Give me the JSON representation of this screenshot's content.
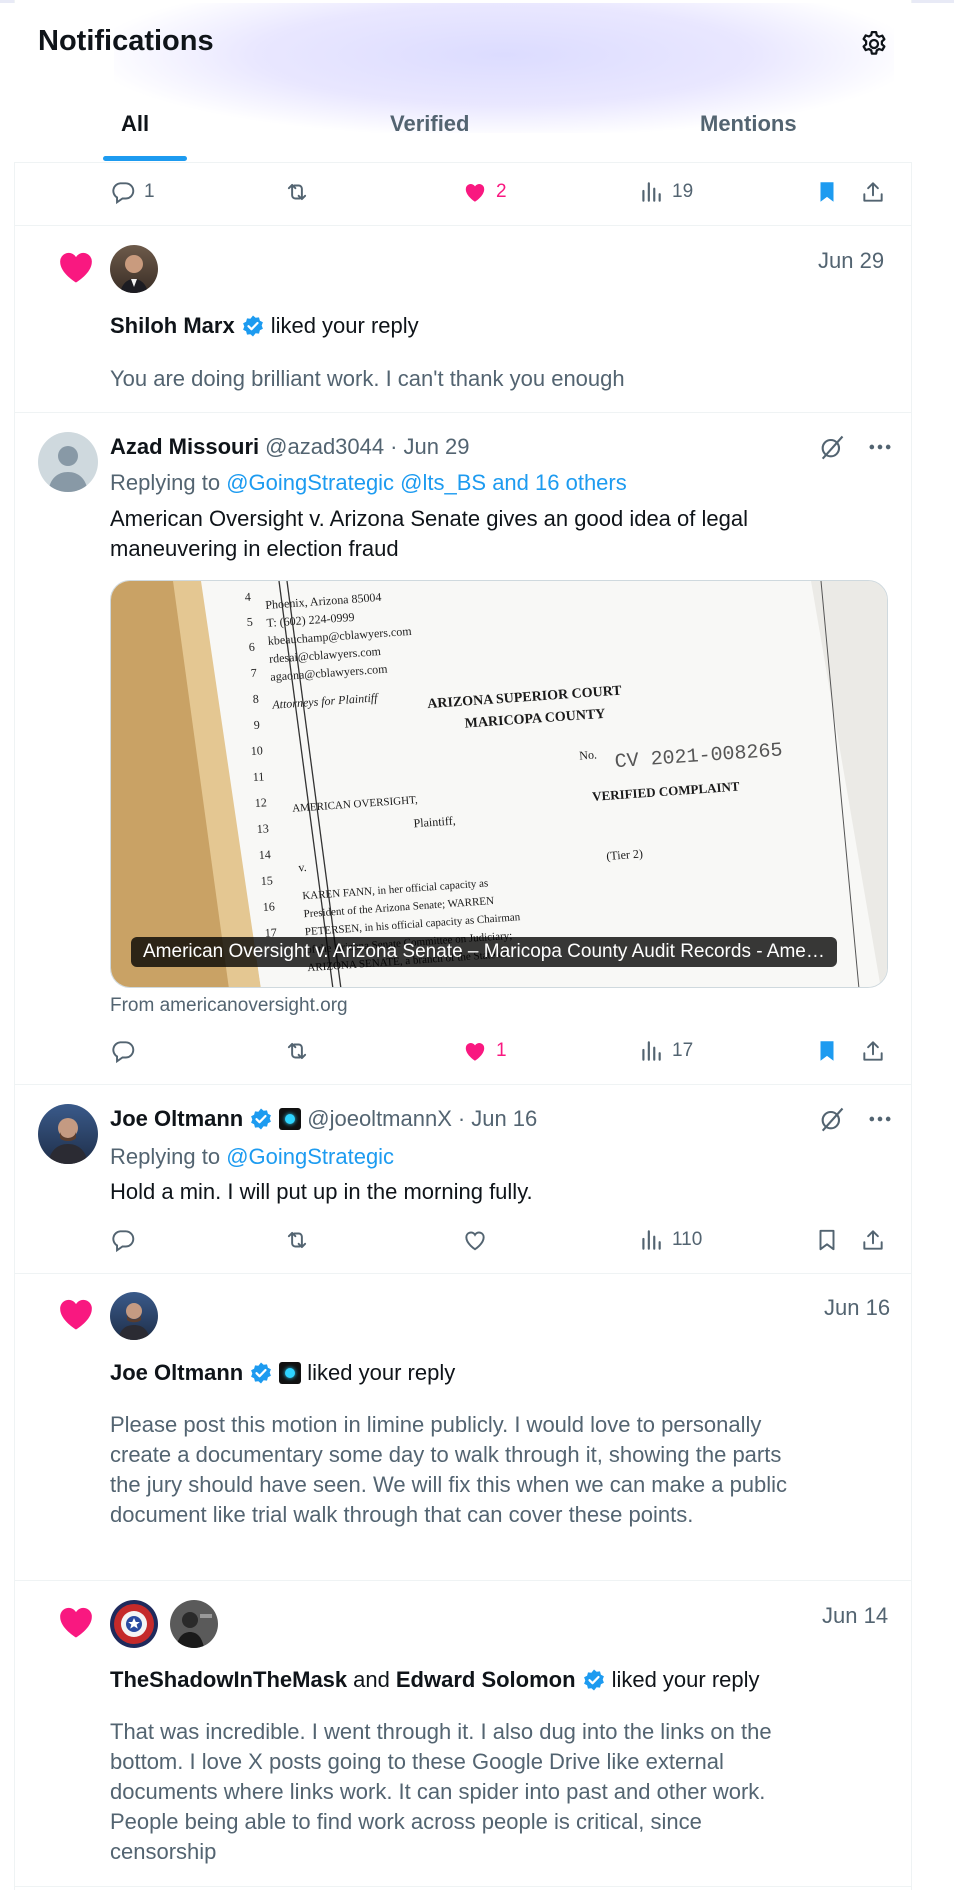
{
  "header": {
    "title": "Notifications",
    "tabs": [
      "All",
      "Verified",
      "Mentions"
    ],
    "active_tab": "All",
    "settings_icon": "gear-icon"
  },
  "colors": {
    "accent": "#1d9bf0",
    "like": "#f91880",
    "muted": "#536471",
    "text": "#0f1419"
  },
  "top_actions": {
    "replies": "1",
    "likes": "2",
    "views": "19"
  },
  "notif1": {
    "date": "Jun 29",
    "user": "Shiloh Marx",
    "action": "liked your reply",
    "body": "You are doing brilliant work.  I can't thank you enough"
  },
  "tweet1": {
    "name": "Azad Missouri",
    "handle": "@azad3044",
    "date": "Jun 29",
    "replying_label": "Replying to",
    "replying_to": "@GoingStrategic @lts_BS and 16 others",
    "text": "American Oversight v. Arizona Senate gives an good idea of legal maneuvering in election fraud",
    "card": {
      "caption": "American Oversight v. Arizona Senate – Maricopa County Audit Records - Ame…",
      "source": "From americanoversight.org",
      "doc_court": "ARIZONA SUPERIOR COURT",
      "doc_county": "MARICOPA COUNTY",
      "doc_case": "CV 2021-008265",
      "doc_title": "VERIFIED COMPLAINT",
      "doc_plaintiff": "AMERICAN OVERSIGHT,",
      "doc_plaintiff_role": "Plaintiff,",
      "doc_tier": "(Tier 2)",
      "doc_no": "No.",
      "doc_v": "v.",
      "doc_attorneys": "Attorneys for Plaintiff",
      "doc_address": [
        "Phoenix, Arizona  85004",
        "T:  (602) 224-0999",
        "kbeauchamp@cblawyers.com",
        "rdesai@cblawyers.com",
        "agaona@cblawyers.com"
      ],
      "doc_defendants": [
        "KAREN FANN, in her official capacity as",
        "President of the Arizona Senate; WARREN",
        "PETERSEN, in his official capacity as Chairman",
        "of the Arizona Senate Committee on Judiciary;",
        "ARIZONA SENATE, a branch of the State of"
      ],
      "doc_line_numbers": [
        "4",
        "5",
        "6",
        "7",
        "8",
        "9",
        "10",
        "11",
        "12",
        "13",
        "14",
        "15",
        "16",
        "17"
      ]
    },
    "likes": "1",
    "views": "17"
  },
  "tweet2": {
    "name": "Joe Oltmann",
    "handle": "@joeoltmannX",
    "date": "Jun 16",
    "replying_label": "Replying to",
    "replying_to": "@GoingStrategic",
    "text": "Hold a min. I will put up in the morning fully.",
    "views": "110"
  },
  "notif2": {
    "date": "Jun 16",
    "user": "Joe Oltmann",
    "action": "liked your reply",
    "body": "Please post this motion in limine publicly.  I would love to personally create a documentary some day to walk through it, showing the parts the jury should have seen.  We will fix this when we can make a public document like trial walk through that can cover these points."
  },
  "notif3": {
    "date": "Jun 14",
    "user1": "TheShadowInTheMask",
    "and": "and",
    "user2": "Edward Solomon",
    "action": "liked your reply",
    "body": "That was incredible. I went through it. I also dug into the links on the bottom. I love X posts going to these Google Drive like external documents where links work. It can spider into past and other work. People being able to find work across people is critical, since censorship"
  }
}
